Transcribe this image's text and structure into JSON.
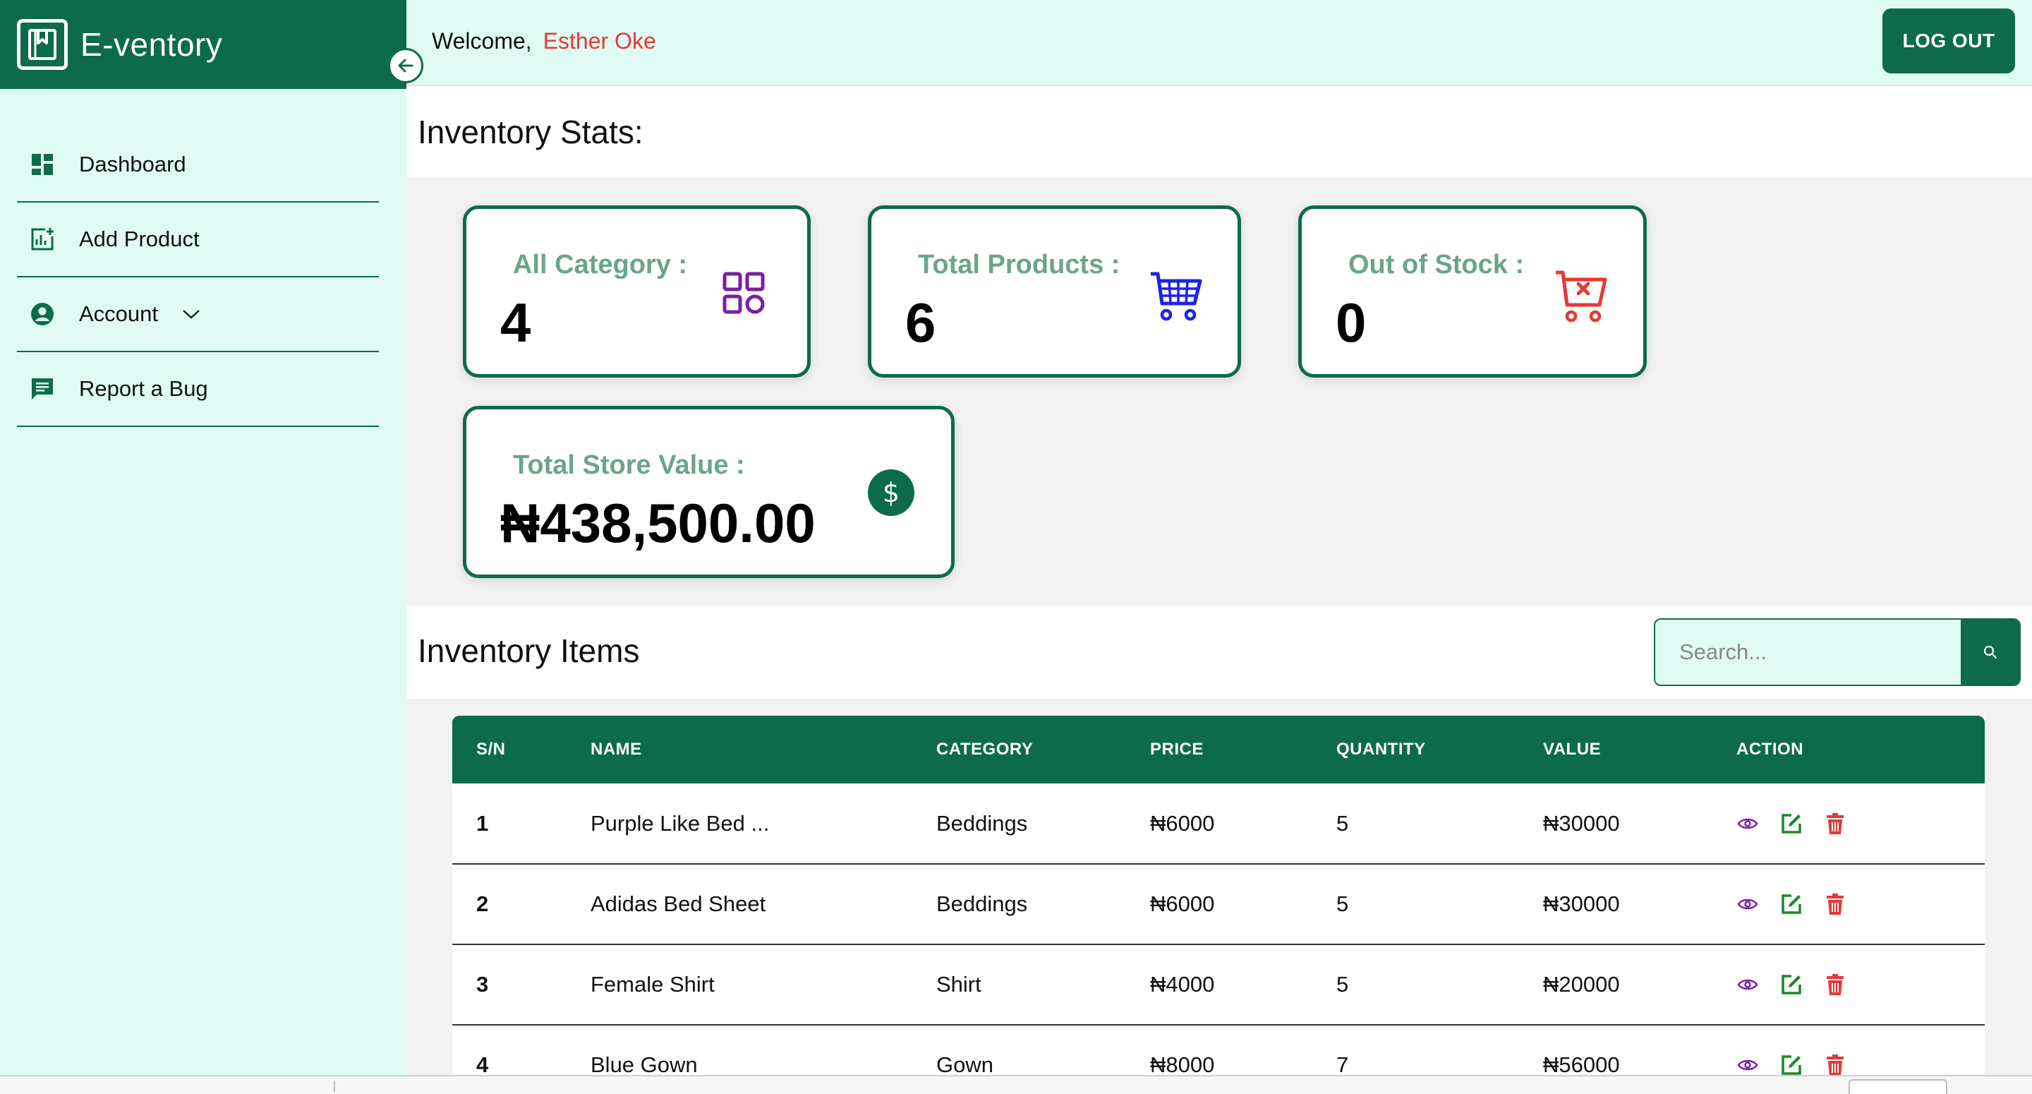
{
  "app": {
    "brand": "E-ventory",
    "colors": {
      "primary": "#0d6b4c",
      "mint": "#e0fbf4",
      "accent_red": "#e53935",
      "purple": "#7b1fa2",
      "blue": "#1e22e8"
    }
  },
  "sidebar": {
    "items": [
      {
        "label": "Dashboard",
        "icon": "dashboard-icon"
      },
      {
        "label": "Add Product",
        "icon": "add-chart-icon"
      },
      {
        "label": "Account",
        "icon": "account-circle-icon",
        "has_dropdown": true
      },
      {
        "label": "Report a Bug",
        "icon": "message-icon"
      }
    ]
  },
  "header": {
    "welcome_text": "Welcome,",
    "user_name": "Esther Oke",
    "logout_label": "LOG OUT"
  },
  "stats": {
    "heading": "Inventory Stats:",
    "cards": [
      {
        "label": "All Category :",
        "value": "4",
        "icon": "category-grid-icon"
      },
      {
        "label": "Total Products :",
        "value": "6",
        "icon": "cart-icon"
      },
      {
        "label": "Out of Stock :",
        "value": "0",
        "icon": "cart-remove-icon"
      },
      {
        "label": "Total Store Value :",
        "value": "₦438,500.00",
        "icon": "dollar-icon"
      }
    ]
  },
  "items": {
    "heading": "Inventory Items",
    "search_placeholder": "Search...",
    "columns": [
      "S/N",
      "NAME",
      "CATEGORY",
      "PRICE",
      "QUANTITY",
      "VALUE",
      "ACTION"
    ],
    "rows": [
      {
        "sn": "1",
        "name": "Purple Like Bed ...",
        "category": "Beddings",
        "price": "₦6000",
        "quantity": "5",
        "value": "₦30000"
      },
      {
        "sn": "2",
        "name": "Adidas Bed Sheet",
        "category": "Beddings",
        "price": "₦6000",
        "quantity": "5",
        "value": "₦30000"
      },
      {
        "sn": "3",
        "name": "Female Shirt",
        "category": "Shirt",
        "price": "₦4000",
        "quantity": "5",
        "value": "₦20000"
      },
      {
        "sn": "4",
        "name": "Blue Gown",
        "category": "Gown",
        "price": "₦8000",
        "quantity": "7",
        "value": "₦56000"
      }
    ],
    "action_icons": [
      "view-eye-icon",
      "edit-icon",
      "delete-trash-icon"
    ]
  }
}
